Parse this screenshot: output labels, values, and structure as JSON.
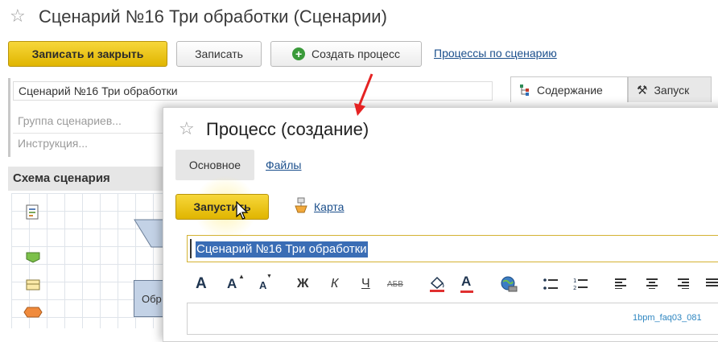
{
  "main": {
    "title": "Сценарий №16 Три обработки (Сценарии)",
    "toolbar": {
      "save_close": "Записать и закрыть",
      "save": "Записать",
      "create_process": "Создать процесс",
      "processes_link": "Процессы по сценарию"
    },
    "name_value": "Сценарий №16 Три обработки",
    "group_placeholder": "Группа сценариев...",
    "instruction_placeholder": "Инструкция...",
    "schema_title": "Схема сценария",
    "schema_node_label": "Обр",
    "tabs": [
      "Содержание",
      "Запуск"
    ]
  },
  "dialog": {
    "title": "Процесс (создание)",
    "tabs": [
      "Основное",
      "Файлы"
    ],
    "run_button": "Запустить",
    "map_link": "Карта",
    "text_value": "Сценарий №16 Три обработки",
    "format_toolbar": {
      "bold_a": "A",
      "grow_a": "A",
      "shrink_a": "A",
      "bold": "Ж",
      "italic": "К",
      "underline": "Ч",
      "strike": "АБВ",
      "font_color_a": "A"
    }
  },
  "watermark": "1bpm_faq03_081",
  "colors": {
    "accent_yellow": "#e7c21a",
    "link_blue": "#1b4f8c",
    "selection": "#3a6db5",
    "arrow_red": "#e52222"
  }
}
